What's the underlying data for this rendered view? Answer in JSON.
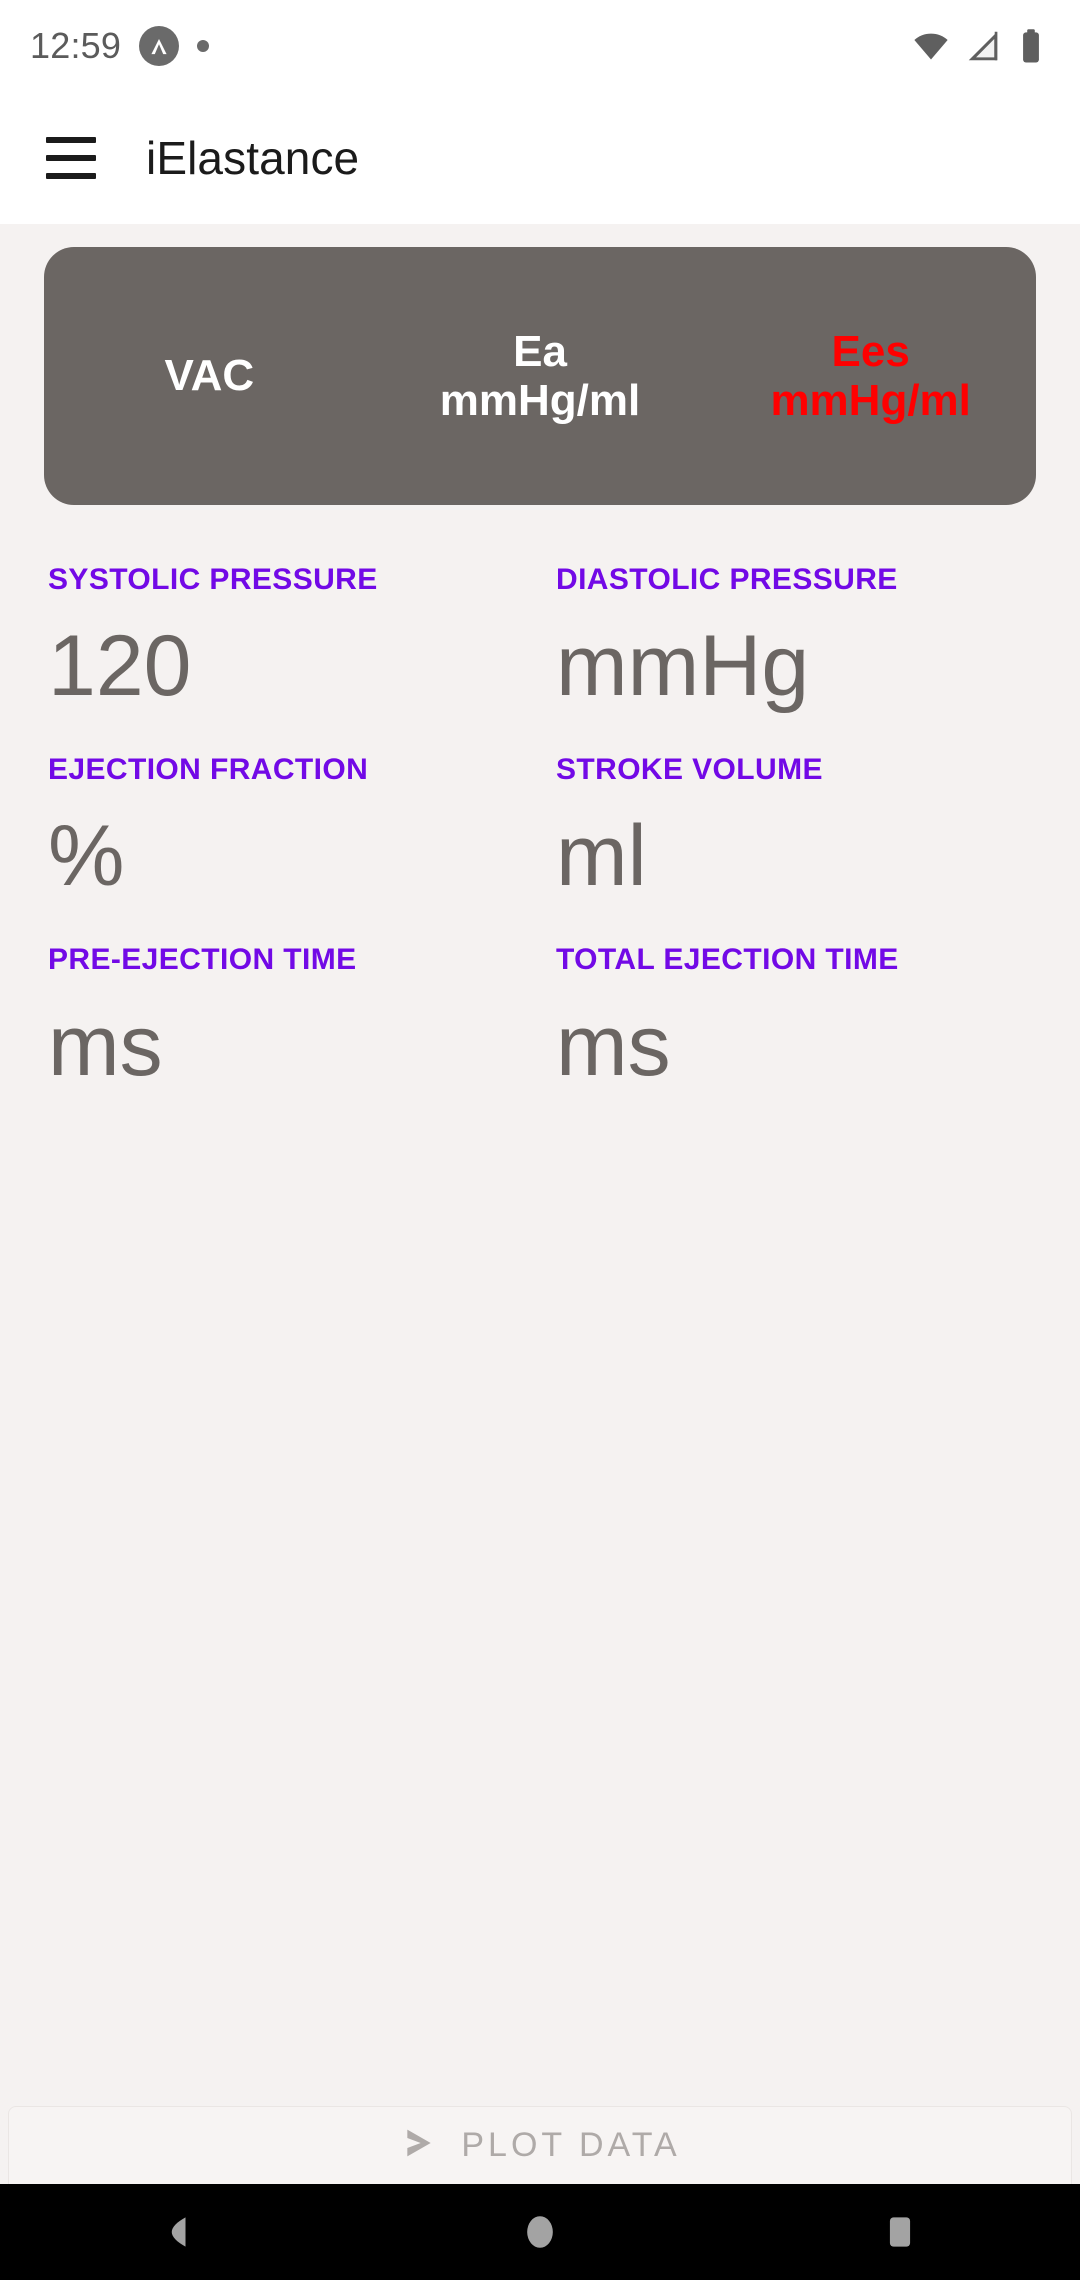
{
  "status_bar": {
    "clock": "12:59",
    "app_badge_icon": "caret-up-circle-icon",
    "notification_dot_icon": "notification-dot-icon",
    "wifi_icon": "wifi-icon",
    "signal_icon": "cellular-signal-icon",
    "battery_icon": "battery-full-icon"
  },
  "app_bar": {
    "menu_icon": "hamburger-menu-icon",
    "title": "iElastance"
  },
  "results_card": {
    "background_color": "#6B6663",
    "columns": [
      {
        "name": "VAC",
        "unit": "",
        "color": "#FFFFFF"
      },
      {
        "name": "Ea",
        "unit": "mmHg/ml",
        "color": "#FFFFFF"
      },
      {
        "name": "Ees",
        "unit": "mmHg/ml",
        "color": "#FF0000"
      }
    ]
  },
  "form": {
    "label_color": "#7209E6",
    "value_color": "#6B6663",
    "fields": [
      {
        "label": "SYSTOLIC PRESSURE",
        "value": "120",
        "placeholder": "mmHg"
      },
      {
        "label": "DIASTOLIC PRESSURE",
        "value": "",
        "placeholder": "mmHg"
      },
      {
        "label": "EJECTION FRACTION",
        "value": "",
        "placeholder": "%"
      },
      {
        "label": "STROKE VOLUME",
        "value": "",
        "placeholder": "ml"
      },
      {
        "label": "PRE-EJECTION TIME",
        "value": "",
        "placeholder": "ms"
      },
      {
        "label": "TOTAL EJECTION TIME",
        "value": "",
        "placeholder": "ms"
      }
    ]
  },
  "bottom_bar": {
    "plot_icon": "send-triangle-icon",
    "plot_label": "PLOT DATA",
    "plot_enabled": false
  },
  "nav_bar": {
    "back_icon": "back-triangle-icon",
    "home_icon": "home-circle-icon",
    "recents_icon": "recents-square-icon"
  }
}
